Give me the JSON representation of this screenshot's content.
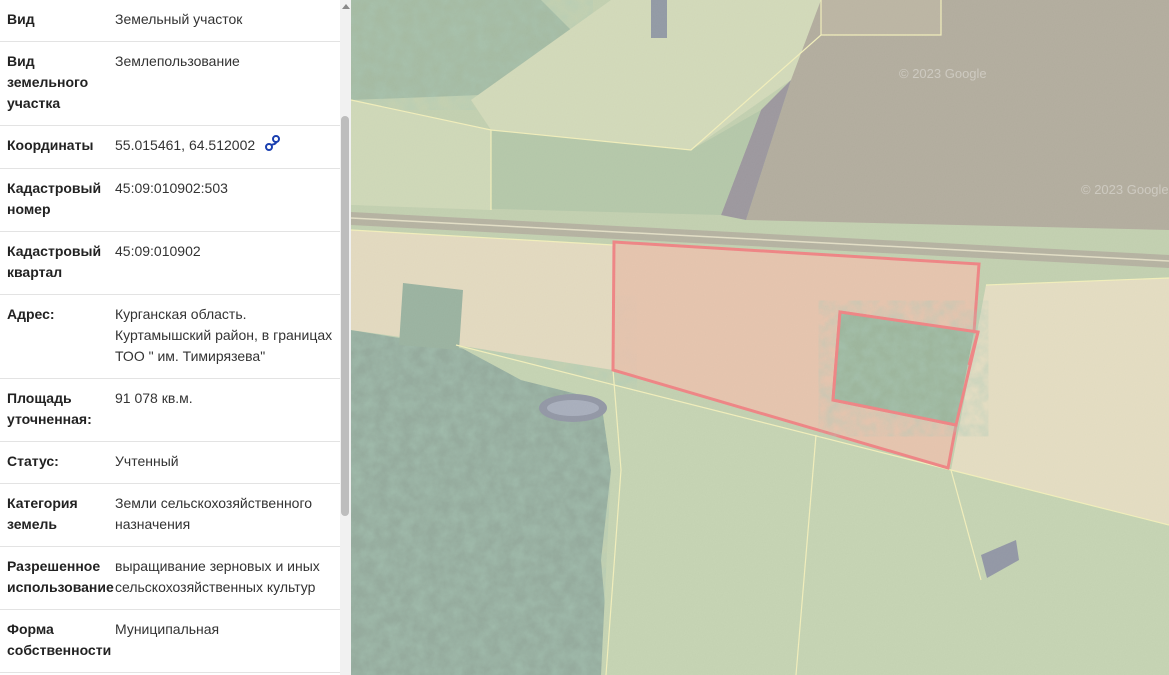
{
  "properties": [
    {
      "label": "Вид",
      "value": "Земельный участок"
    },
    {
      "label": "Вид земельного участка",
      "value": "Землепользование"
    },
    {
      "label": "Координаты",
      "value": "55.015461, 64.512002",
      "icon": "route-icon"
    },
    {
      "label": "Кадастровый номер",
      "value": "45:09:010902:503"
    },
    {
      "label": "Кадастровый квартал",
      "value": "45:09:010902"
    },
    {
      "label": "Адрес:",
      "value": "Курганская область. Куртамышский район, в границах ТОО \" им. Тимирязева\""
    },
    {
      "label": "Площадь уточненная:",
      "value": "91 078 кв.м."
    },
    {
      "label": "Статус:",
      "value": "Учтенный"
    },
    {
      "label": "Категория земель",
      "value": "Земли сельскохозяйственного назначения"
    },
    {
      "label": "Разрешенное использование",
      "value": "выращивание зерновых и иных сельскохозяйственных культур"
    },
    {
      "label": "Форма собственности",
      "value": "Муниципальная"
    }
  ],
  "map": {
    "watermarks": [
      "© 2023 Google",
      "© 2023 Google"
    ],
    "colors": {
      "parcel_border": "#e01010",
      "parcel_fill": "#e0806080",
      "boundary": "#e6e07a"
    }
  }
}
